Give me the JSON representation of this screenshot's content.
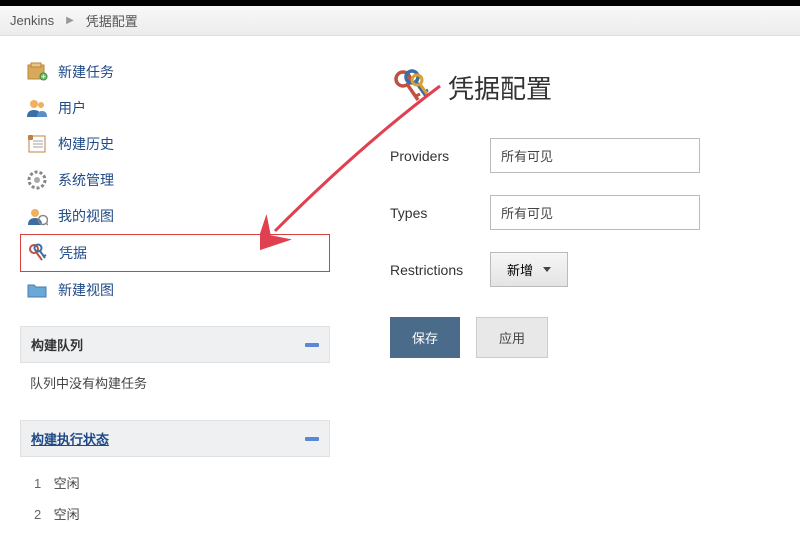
{
  "breadcrumb": {
    "root": "Jenkins",
    "current": "凭据配置"
  },
  "sidebar": {
    "items": [
      {
        "label": "新建任务"
      },
      {
        "label": "用户"
      },
      {
        "label": "构建历史"
      },
      {
        "label": "系统管理"
      },
      {
        "label": "我的视图"
      },
      {
        "label": "凭据"
      },
      {
        "label": "新建视图"
      }
    ]
  },
  "panels": {
    "buildQueue": {
      "title": "构建队列",
      "empty": "队列中没有构建任务"
    },
    "executors": {
      "title": "构建执行状态",
      "list": [
        {
          "num": "1",
          "status": "空闲"
        },
        {
          "num": "2",
          "status": "空闲"
        }
      ]
    }
  },
  "page": {
    "title": "凭据配置",
    "providersLabel": "Providers",
    "providersValue": "所有可见",
    "typesLabel": "Types",
    "typesValue": "所有可见",
    "restrictionsLabel": "Restrictions",
    "restrictionsBtn": "新增",
    "save": "保存",
    "apply": "应用"
  }
}
